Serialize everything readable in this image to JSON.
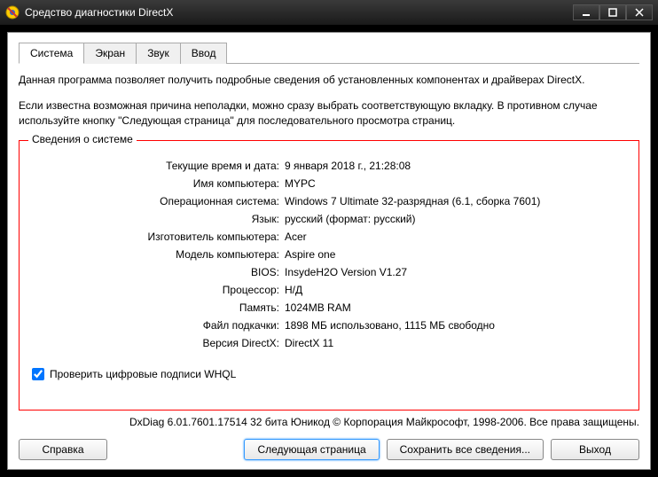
{
  "window": {
    "title": "Средство диагностики DirectX"
  },
  "tabs": {
    "system": "Система",
    "display": "Экран",
    "sound": "Звук",
    "input": "Ввод"
  },
  "intro1": "Данная программа позволяет получить подробные сведения об установленных компонентах и драйверах DirectX.",
  "intro2": "Если известна возможная причина неполадки, можно сразу выбрать соответствующую вкладку. В противном случае используйте кнопку \"Следующая страница\" для последовательного просмотра страниц.",
  "fieldset": {
    "legend": "Сведения о системе"
  },
  "info": {
    "datetime": {
      "label": "Текущие время и дата:",
      "value": "9 января 2018 г., 21:28:08"
    },
    "computer_name": {
      "label": "Имя компьютера:",
      "value": "MYPC"
    },
    "os": {
      "label": "Операционная система:",
      "value": "Windows 7 Ultimate 32-разрядная (6.1, сборка 7601)"
    },
    "language": {
      "label": "Язык:",
      "value": "русский (формат: русский)"
    },
    "manufacturer": {
      "label": "Изготовитель компьютера:",
      "value": "Acer"
    },
    "model": {
      "label": "Модель компьютера:",
      "value": "Aspire one"
    },
    "bios": {
      "label": "BIOS:",
      "value": "InsydeH2O Version V1.27"
    },
    "processor": {
      "label": "Процессор:",
      "value": "Н/Д"
    },
    "memory": {
      "label": "Память:",
      "value": "1024MB RAM"
    },
    "pagefile": {
      "label": "Файл подкачки:",
      "value": "1898 МБ использовано, 1115 МБ свободно"
    },
    "directx": {
      "label": "Версия DirectX:",
      "value": "DirectX 11"
    }
  },
  "whql": {
    "label": "Проверить цифровые подписи WHQL"
  },
  "footer": "DxDiag 6.01.7601.17514 32 бита Юникод  © Корпорация Майкрософт, 1998-2006.  Все права защищены.",
  "buttons": {
    "help": "Справка",
    "next": "Следующая страница",
    "save": "Сохранить все сведения...",
    "exit": "Выход"
  }
}
